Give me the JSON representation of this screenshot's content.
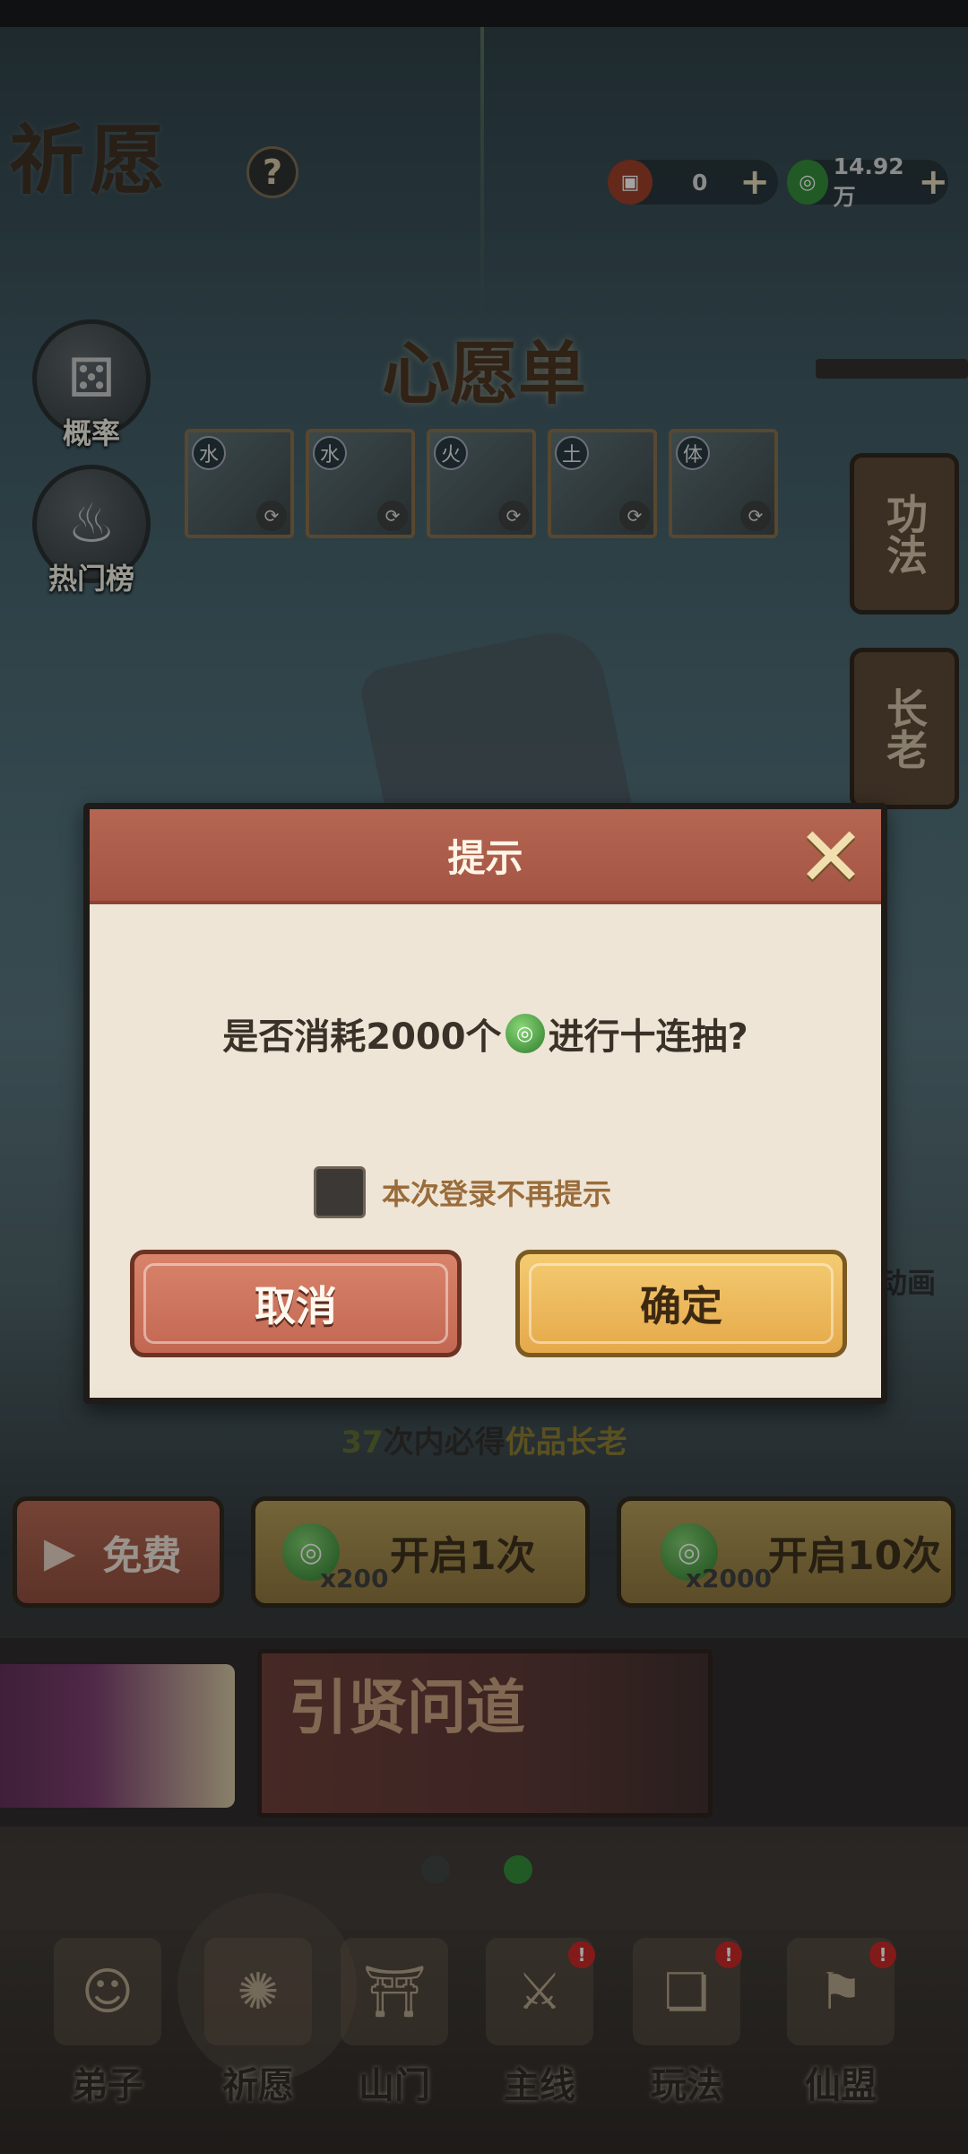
{
  "header": {
    "title": "祈愿",
    "help_label": "?",
    "currencies": [
      {
        "icon": "scroll-ticket-icon",
        "value": "0"
      },
      {
        "icon": "jade-coin-icon",
        "value": "14.92万"
      }
    ]
  },
  "side_buttons": [
    {
      "label": "概率",
      "icon": "dice-icon"
    },
    {
      "label": "热门榜",
      "icon": "flame-icon"
    }
  ],
  "wishlist": {
    "title": "心愿单",
    "cards": [
      {
        "element": "水"
      },
      {
        "element": "水"
      },
      {
        "element": "火"
      },
      {
        "element": "土"
      },
      {
        "element": "体"
      }
    ]
  },
  "lanterns": [
    {
      "label": "功法"
    },
    {
      "label": "长老"
    }
  ],
  "partial_text": "动画",
  "guarantee": {
    "count": "37",
    "mid": "次内必得",
    "reward": "优品长老"
  },
  "actions": [
    {
      "label": "免费"
    },
    {
      "label": "开启1次",
      "cost": "x200"
    },
    {
      "label": "开启10次",
      "cost": "x2000"
    }
  ],
  "banner": {
    "title": "引贤问道"
  },
  "bottom_nav": [
    {
      "label": "弟子",
      "badge": false
    },
    {
      "label": "祈愿",
      "badge": false,
      "active": true
    },
    {
      "label": "山门",
      "badge": false
    },
    {
      "label": "主线",
      "badge": true
    },
    {
      "label": "玩法",
      "badge": true
    },
    {
      "label": "仙盟",
      "badge": true
    }
  ],
  "dialog": {
    "title": "提示",
    "question_before": "是否消耗2000个",
    "question_after": "进行十连抽?",
    "dont_remind": "本次登录不再提示",
    "cancel_label": "取消",
    "confirm_label": "确定"
  }
}
